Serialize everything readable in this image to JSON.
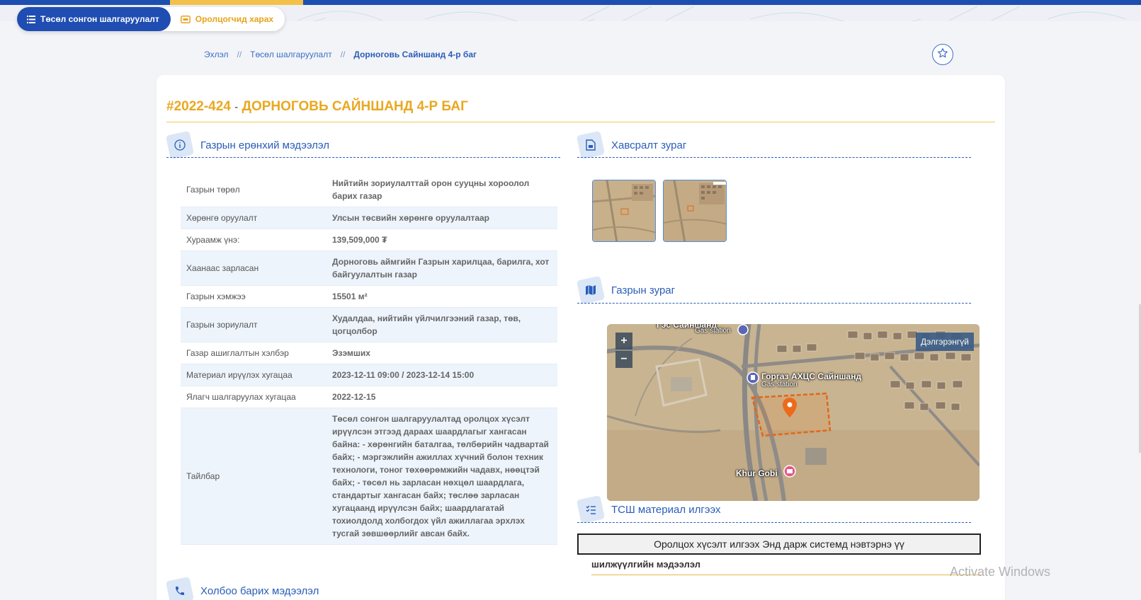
{
  "header": {
    "primary_pill": "Төсөл сонгон шалгаруулалт",
    "secondary_pill": "Оролцогчид харах"
  },
  "breadcrumb": {
    "home": "Эхлэл",
    "separator": "//",
    "section": "Төсөл шалгаруулалт",
    "current": "Дорноговь Сайншанд 4-р баг"
  },
  "page": {
    "code": "#2022-424",
    "dash": "-",
    "title": "ДОРНОГОВЬ САЙНШАНД 4-Р БАГ"
  },
  "sections": {
    "general": "Газрын ерөнхий мэдээлэл",
    "attachments": "Хавсралт зураг",
    "map": "Газрын зураг",
    "materials": "ТСШ материал илгээх",
    "contact": "Холбоо барих мэдээлэл"
  },
  "info_rows": [
    {
      "key": "Газрын төрөл",
      "value": "Нийтийн зориулалттай орон сууцны хороолол барих газар"
    },
    {
      "key": "Хөрөнгө оруулалт",
      "value": "Улсын төсвийн хөрөнгө оруулалтаар"
    },
    {
      "key": "Хураамж үнэ:",
      "value": "139,509,000 ₮"
    },
    {
      "key": "Хаанаас зарласан",
      "value": "Дорноговь аймгийн Газрын харилцаа, барилга, хот байгуулалтын газар"
    },
    {
      "key": "Газрын хэмжээ",
      "value": "15501 м²"
    },
    {
      "key": "Газрын зориулалт",
      "value": "Худалдаа, нийтийн үйлчилгээний газар, төв, цогцолбор"
    },
    {
      "key": "Газар ашиглалтын хэлбэр",
      "value": "Эзэмших"
    },
    {
      "key": "Материал ирүүлэх хугацаа",
      "value": "2023-12-11 09:00 / 2023-12-14 15:00"
    },
    {
      "key": "Ялагч шалгаруулах хугацаа",
      "value": "2022-12-15"
    },
    {
      "key": "Тайлбар",
      "value": "Төсөл сонгон шалгаруулалтад оролцох хүсэлт ирүүлсэн этгээд дараах шаардлагыг хангасан байна: - хөрөнгийн баталгаа, төлбөрийн чадвартай байх; - мэргэжлийн ажиллах хүчний болон техник технологи, тоног төхөөрөмжийн чадавх, нөөцтэй байх; - төсөл нь зарласан нөхцөл шаардлага, стандартыг хангасан байх; төслөө зарласан хугацаанд ирүүлсэн байх; шаардлагатай тохиолдолд холбогдох үйл ажиллагаа эрхлэх тусгай зөвшөөрлийг авсан байх."
    }
  ],
  "map": {
    "zoom_in": "+",
    "zoom_out": "−",
    "layer_button": "Дэлгэрэнгүй",
    "labels": {
      "top_station": "Гэс Сайншанд",
      "top_station_sub": "Gas station",
      "station": "Горгаз АХЦС Сайншанд",
      "station_sub": "Gas station",
      "hotel": "Khur Gobi"
    }
  },
  "apply_button": "Оролцох хүсэлт илгээх Энд дарж системд нэвтэрнэ үү",
  "transfer_info": "шилжүүлгийн мэдээлэл",
  "watermark": "Activate Windows",
  "colors": {
    "primary": "#1f4db2",
    "accent": "#e9a820",
    "link": "#2a5db8"
  }
}
